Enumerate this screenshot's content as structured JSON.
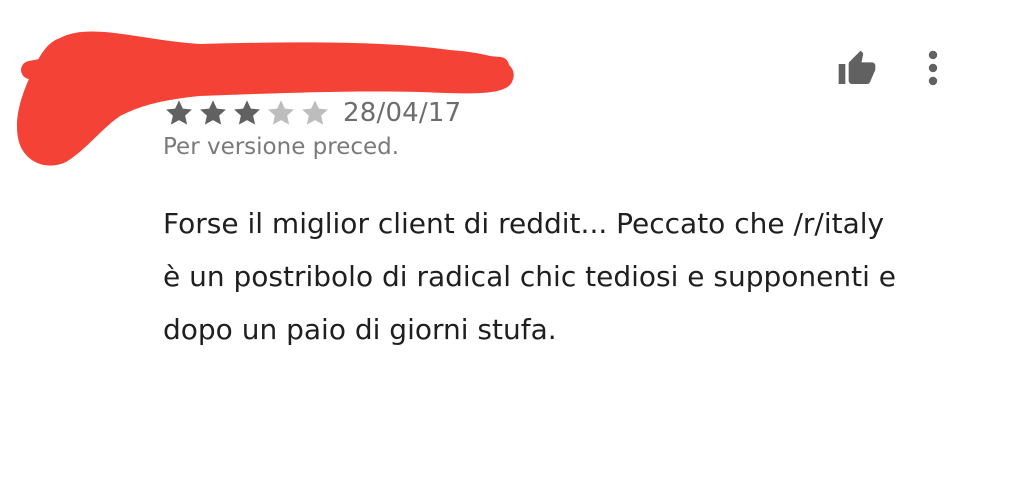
{
  "review": {
    "rating": 3,
    "max_rating": 5,
    "date": "28/04/17",
    "version_note": "Per versione preced.",
    "body_lines": [
      "Forse il miglior client di reddit... Peccato che /r/italy",
      "è un postribolo di radical chic tediosi e supponenti e",
      "dopo un paio di giorni stufa."
    ]
  },
  "actions": {
    "helpful_icon": "thumbs-up-icon",
    "more_icon": "more-vert-icon"
  },
  "colors": {
    "star_filled": "#616161",
    "star_empty": "#bdbdbd",
    "icon": "#616161",
    "redaction": "#f44336",
    "text": "#1f1f1f",
    "meta_text": "#6d6d6d"
  }
}
